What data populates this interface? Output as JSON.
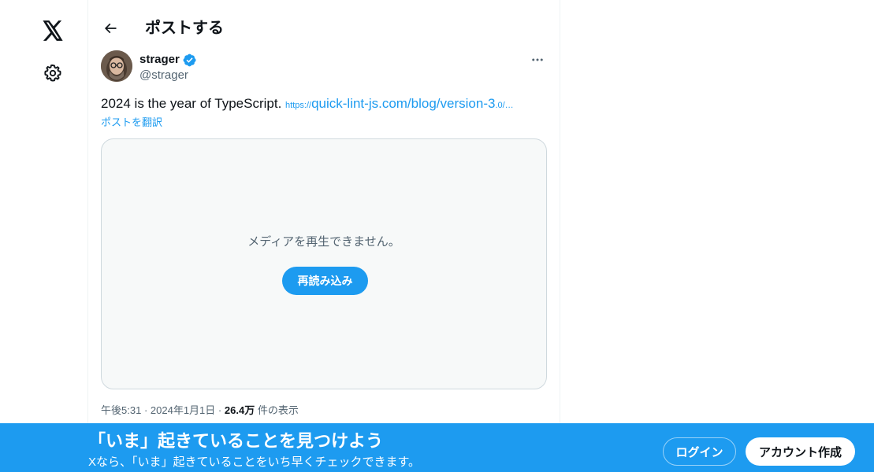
{
  "nav": {
    "logo_icon": "x-logo-icon",
    "settings_icon": "gear-icon"
  },
  "header": {
    "back_icon": "arrow-left-icon",
    "title": "ポストする"
  },
  "post": {
    "author": {
      "display_name": "strager",
      "handle": "@strager",
      "verified": true,
      "verified_color": "#1d9bf0"
    },
    "more_icon": "more-dots-icon",
    "text": "2024 is the year of TypeScript. ",
    "link": {
      "prefix": "https://",
      "main": "quick-lint-js.com/blog/version-3",
      "suffix": ".0/…"
    },
    "translate_label": "ポストを翻訳",
    "media": {
      "message": "メディアを再生できません。",
      "reload_label": "再読み込み"
    },
    "meta": {
      "time": "午後5:31",
      "date": "2024年1月1日",
      "views": "26.4万",
      "views_label": "件の表示",
      "separator": "·"
    }
  },
  "banner": {
    "title": "「いま」起きていることを見つけよう",
    "subtitle": "Xなら、「いま」起きていることをいち早くチェックできます。",
    "login_label": "ログイン",
    "signup_label": "アカウント作成",
    "background": "#1d9bf0"
  },
  "colors": {
    "accent": "#1d9bf0",
    "text_primary": "#0f1419",
    "text_secondary": "#536471"
  }
}
